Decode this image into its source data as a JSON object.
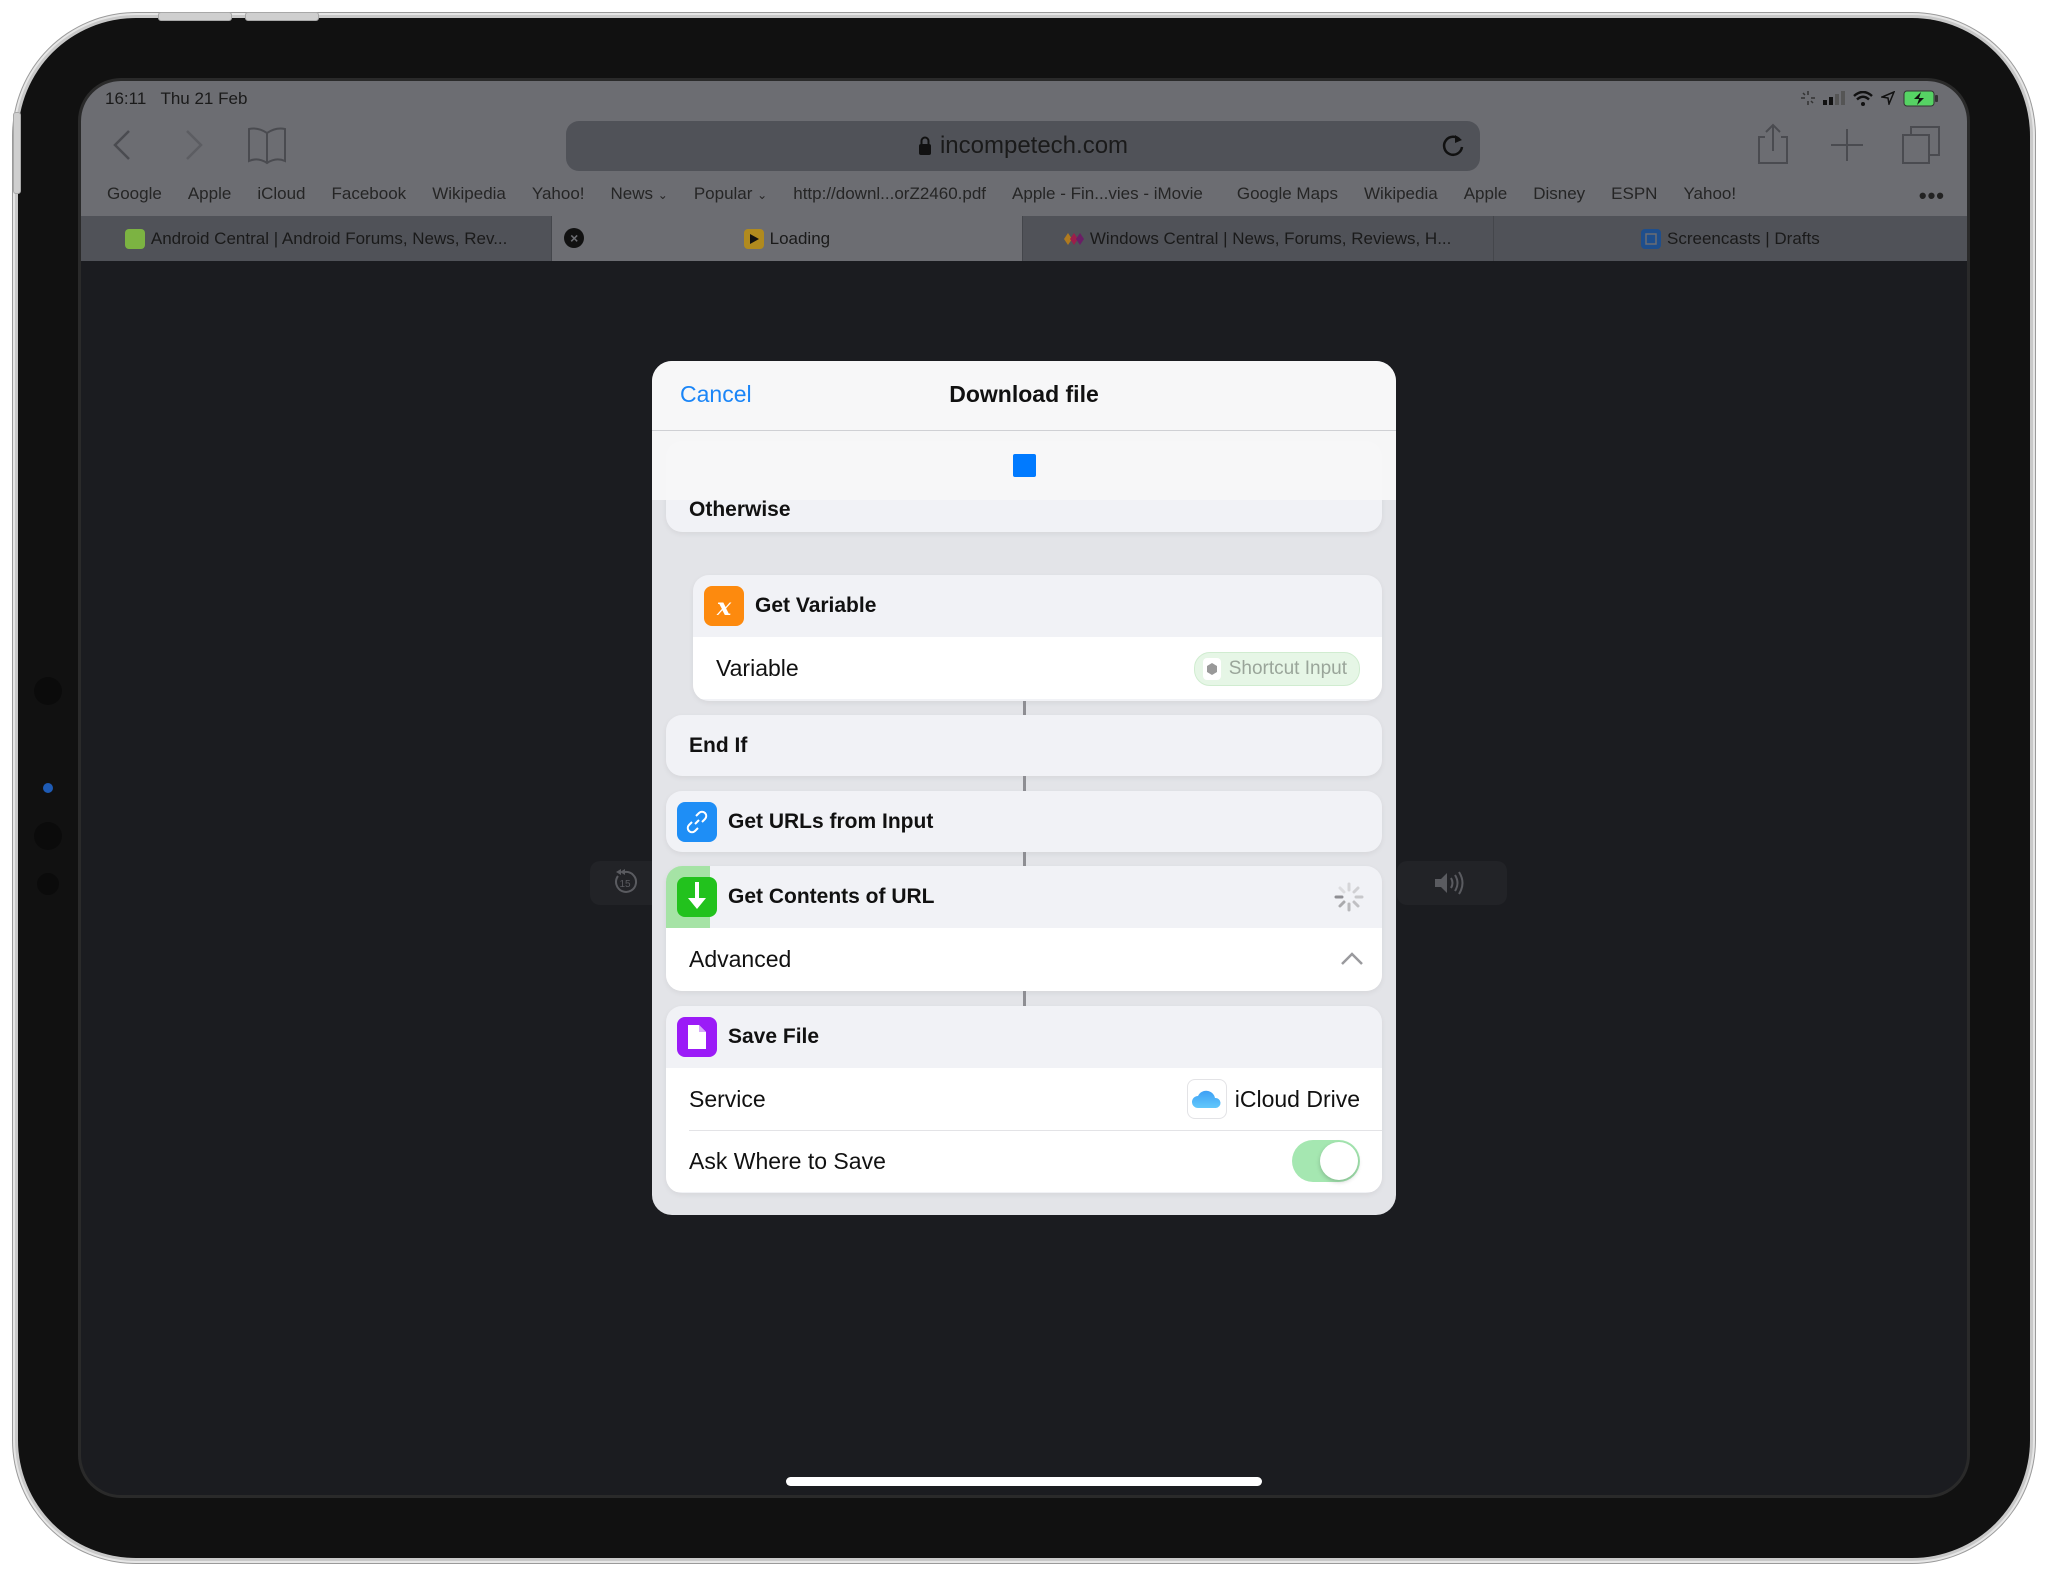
{
  "status_bar": {
    "time": "16:11",
    "date": "Thu 21 Feb",
    "icons": [
      "activity-spinner-icon",
      "cellular-signal-icon",
      "wifi-icon",
      "location-arrow-icon",
      "battery-charging-icon"
    ]
  },
  "browser": {
    "url": "incompetech.com",
    "toolbar_icons": [
      "back-icon",
      "forward-icon",
      "bookmarks-book-icon",
      "reload-icon",
      "share-icon",
      "new-tab-plus-icon",
      "tabs-overview-icon"
    ],
    "bookmarks": [
      "Google",
      "Apple",
      "iCloud",
      "Facebook",
      "Wikipedia",
      "Yahoo!",
      "News",
      "Popular",
      "http://downl...orZ2460.pdf",
      "Apple - Fin...vies - iMovie",
      "Google Maps",
      "Wikipedia",
      "Apple",
      "Disney",
      "ESPN",
      "Yahoo!"
    ],
    "bookmark_folders": {
      "news": "⌄",
      "popular": "⌄"
    },
    "more_label": "•••",
    "tabs": [
      {
        "title": "Android Central | Android Forums, News, Rev...",
        "active": false,
        "favicon_color": "#7cb342"
      },
      {
        "title": "Loading",
        "active": true,
        "favicon_color": "#b08a1e"
      },
      {
        "title": "Windows Central | News, Forums, Reviews, H...",
        "active": false,
        "favicon_color": "#c2185b"
      },
      {
        "title": "Screencasts | Drafts",
        "active": false,
        "favicon_color": "#1e4e8c"
      }
    ],
    "close_tab_glyph": "×"
  },
  "media": {
    "skip_back_label": "15",
    "volume_icon": "speaker-volume-icon"
  },
  "modal": {
    "cancel_label": "Cancel",
    "title": "Download file",
    "partial_card_label": "Otherwise",
    "actions": [
      {
        "title": "Get Variable",
        "icon": "variable-x-icon",
        "icon_color": "#fd8a0e",
        "glyph": "x",
        "param_label": "Variable",
        "param_value": "Shortcut Input"
      },
      {
        "title": "End If"
      },
      {
        "title": "Get URLs from Input",
        "icon": "link-icon",
        "icon_color": "#1e8ef6"
      },
      {
        "title": "Get Contents of URL",
        "icon": "download-arrow-icon",
        "icon_color": "#22c21d",
        "status": "running",
        "param_label": "Advanced"
      },
      {
        "title": "Save File",
        "icon": "document-icon",
        "icon_color": "#9b1bf7",
        "param_label": "Service",
        "param_value": "iCloud Drive",
        "param2_label": "Ask Where to Save",
        "param2_on": true
      }
    ]
  },
  "colors": {
    "accent_blue": "#007aff",
    "link_blue": "#1a85f7",
    "toggle_on": "#a5e7b1"
  }
}
